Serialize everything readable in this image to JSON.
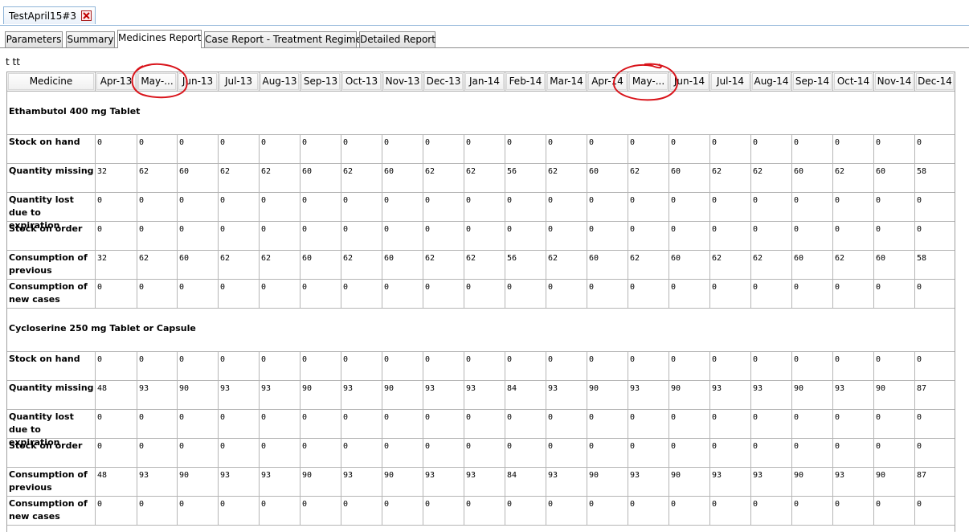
{
  "doc_tab": {
    "title": "TestApril15#3",
    "close_icon": "close-icon"
  },
  "tabs": [
    {
      "label": "Parameters"
    },
    {
      "label": "Summary"
    },
    {
      "label": "Medicines Report",
      "active": true
    },
    {
      "label": "Case Report - Treatment Regimen"
    },
    {
      "label": "Detailed Report"
    }
  ],
  "caption": "t tt",
  "table": {
    "header_first": "Medicine",
    "months": [
      "Apr-13",
      "May-...",
      "Jun-13",
      "Jul-13",
      "Aug-13",
      "Sep-13",
      "Oct-13",
      "Nov-13",
      "Dec-13",
      "Jan-14",
      "Feb-14",
      "Mar-14",
      "Apr-14",
      "May-...",
      "Jun-14",
      "Jul-14",
      "Aug-14",
      "Sep-14",
      "Oct-14",
      "Nov-14",
      "Dec-14"
    ],
    "medicines": [
      {
        "name": "Ethambutol  400 mg  Tablet",
        "rows": [
          {
            "label": "Stock on hand",
            "values": [
              "0",
              "0",
              "0",
              "0",
              "0",
              "0",
              "0",
              "0",
              "0",
              "0",
              "0",
              "0",
              "0",
              "0",
              "0",
              "0",
              "0",
              "0",
              "0",
              "0",
              "0"
            ]
          },
          {
            "label": "Quantity missing",
            "values": [
              "32",
              "62",
              "60",
              "62",
              "62",
              "60",
              "62",
              "60",
              "62",
              "62",
              "56",
              "62",
              "60",
              "62",
              "60",
              "62",
              "62",
              "60",
              "62",
              "60",
              "58"
            ]
          },
          {
            "label": "Quantity lost due to expiration",
            "values": [
              "0",
              "0",
              "0",
              "0",
              "0",
              "0",
              "0",
              "0",
              "0",
              "0",
              "0",
              "0",
              "0",
              "0",
              "0",
              "0",
              "0",
              "0",
              "0",
              "0",
              "0"
            ]
          },
          {
            "label": "Stock on order",
            "values": [
              "0",
              "0",
              "0",
              "0",
              "0",
              "0",
              "0",
              "0",
              "0",
              "0",
              "0",
              "0",
              "0",
              "0",
              "0",
              "0",
              "0",
              "0",
              "0",
              "0",
              "0"
            ]
          },
          {
            "label": "Consumption of previous",
            "values": [
              "32",
              "62",
              "60",
              "62",
              "62",
              "60",
              "62",
              "60",
              "62",
              "62",
              "56",
              "62",
              "60",
              "62",
              "60",
              "62",
              "62",
              "60",
              "62",
              "60",
              "58"
            ]
          },
          {
            "label": "Consumption of new cases",
            "values": [
              "0",
              "0",
              "0",
              "0",
              "0",
              "0",
              "0",
              "0",
              "0",
              "0",
              "0",
              "0",
              "0",
              "0",
              "0",
              "0",
              "0",
              "0",
              "0",
              "0",
              "0"
            ]
          }
        ]
      },
      {
        "name": "Cycloserine  250 mg  Tablet or Capsule",
        "rows": [
          {
            "label": "Stock on hand",
            "values": [
              "0",
              "0",
              "0",
              "0",
              "0",
              "0",
              "0",
              "0",
              "0",
              "0",
              "0",
              "0",
              "0",
              "0",
              "0",
              "0",
              "0",
              "0",
              "0",
              "0",
              "0"
            ]
          },
          {
            "label": "Quantity missing",
            "values": [
              "48",
              "93",
              "90",
              "93",
              "93",
              "90",
              "93",
              "90",
              "93",
              "93",
              "84",
              "93",
              "90",
              "93",
              "90",
              "93",
              "93",
              "90",
              "93",
              "90",
              "87"
            ]
          },
          {
            "label": "Quantity lost due to expiration",
            "values": [
              "0",
              "0",
              "0",
              "0",
              "0",
              "0",
              "0",
              "0",
              "0",
              "0",
              "0",
              "0",
              "0",
              "0",
              "0",
              "0",
              "0",
              "0",
              "0",
              "0",
              "0"
            ]
          },
          {
            "label": "Stock on order",
            "values": [
              "0",
              "0",
              "0",
              "0",
              "0",
              "0",
              "0",
              "0",
              "0",
              "0",
              "0",
              "0",
              "0",
              "0",
              "0",
              "0",
              "0",
              "0",
              "0",
              "0",
              "0"
            ]
          },
          {
            "label": "Consumption of previous",
            "values": [
              "48",
              "93",
              "90",
              "93",
              "93",
              "90",
              "93",
              "90",
              "93",
              "93",
              "84",
              "93",
              "90",
              "93",
              "90",
              "93",
              "93",
              "90",
              "93",
              "90",
              "87"
            ]
          },
          {
            "label": "Consumption of new cases",
            "values": [
              "0",
              "0",
              "0",
              "0",
              "0",
              "0",
              "0",
              "0",
              "0",
              "0",
              "0",
              "0",
              "0",
              "0",
              "0",
              "0",
              "0",
              "0",
              "0",
              "0",
              "0"
            ]
          }
        ]
      }
    ]
  },
  "colors": {
    "annotation": "#d9141b",
    "tab_border": "#8eb4d8",
    "grid_line": "#b5b5b5"
  }
}
